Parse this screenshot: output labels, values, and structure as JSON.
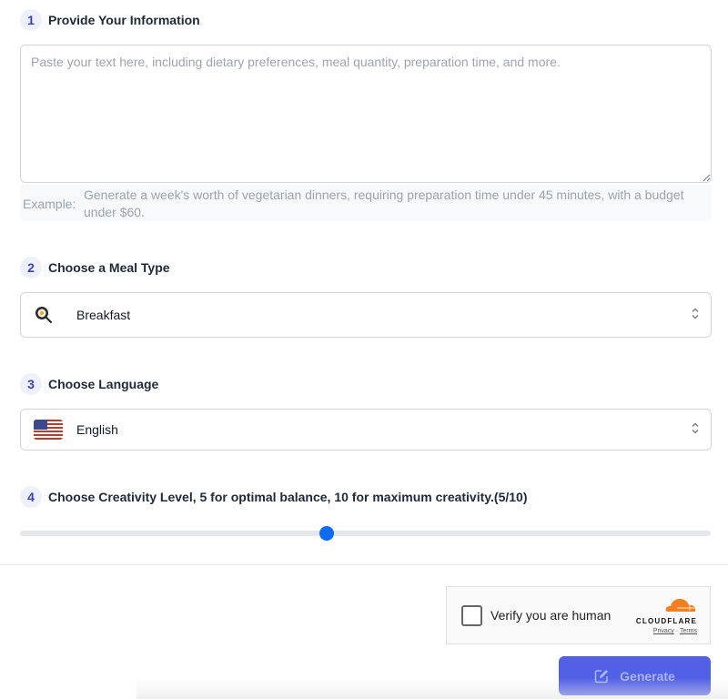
{
  "steps": [
    {
      "number": "1",
      "title": "Provide Your Information"
    },
    {
      "number": "2",
      "title": "Choose a Meal Type"
    },
    {
      "number": "3",
      "title": "Choose Language"
    },
    {
      "number": "4",
      "title": "Choose Creativity Level, 5 for optimal balance, 10 for maximum creativity.(5/10)"
    }
  ],
  "info": {
    "placeholder": "Paste your text here, including dietary preferences, meal quantity, preparation time, and more.",
    "value": "",
    "example_label": "Example:",
    "example_text": "Generate a week's worth of vegetarian dinners, requiring preparation time under 45 minutes, with a budget under $60."
  },
  "meal_type": {
    "selected": "Breakfast",
    "icon": "frying-pan-egg-icon"
  },
  "language": {
    "selected": "English",
    "icon": "us-flag-icon"
  },
  "creativity": {
    "value": 5,
    "min": 1,
    "max": 10
  },
  "captcha": {
    "label": "Verify you are human",
    "brand": "CLOUDFLARE",
    "privacy": "Privacy",
    "separator": "·",
    "terms": "Terms",
    "checked": false
  },
  "generate": {
    "label": "Generate",
    "icon": "edit-icon"
  },
  "colors": {
    "accent": "#5260e6",
    "slider": "#0b6cf5",
    "cloudflare": "#f38020"
  }
}
